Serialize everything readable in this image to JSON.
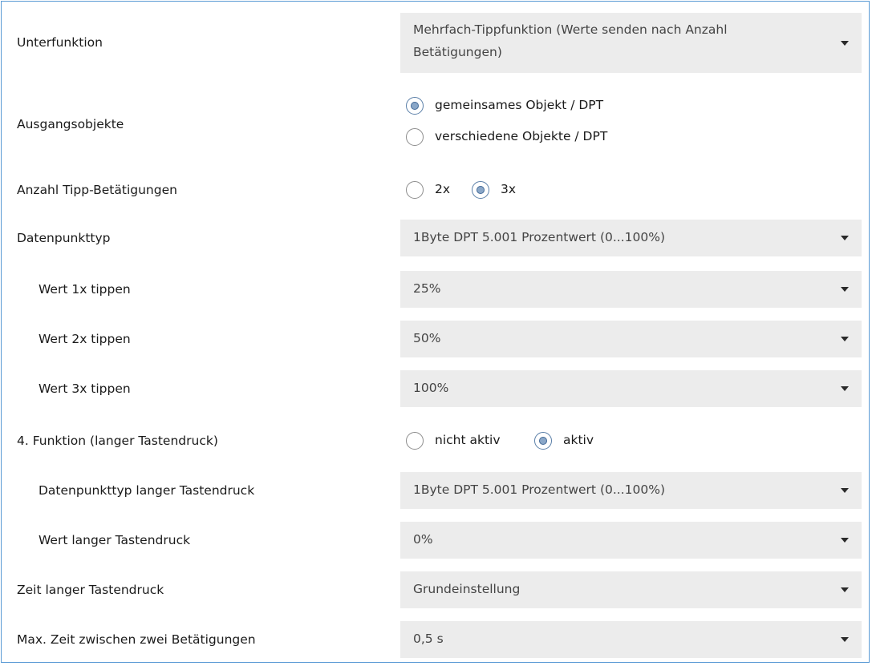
{
  "rows": {
    "unterfunktion": {
      "label": "Unterfunktion",
      "value": "Mehrfach-Tippfunktion (Werte senden nach Anzahl Betätigungen)"
    },
    "ausgangsobjekte": {
      "label": "Ausgangsobjekte",
      "options": [
        "gemeinsames Objekt / DPT",
        "verschiedene Objekte / DPT"
      ],
      "selected": "gemeinsames Objekt / DPT"
    },
    "anzahl_tipp": {
      "label": "Anzahl Tipp-Betätigungen",
      "options": [
        "2x",
        "3x"
      ],
      "selected": "3x"
    },
    "datenpunkttyp": {
      "label": "Datenpunkttyp",
      "value": "1Byte DPT 5.001 Prozentwert (0...100%)"
    },
    "wert1": {
      "label": "Wert 1x tippen",
      "value": "25%"
    },
    "wert2": {
      "label": "Wert 2x tippen",
      "value": "50%"
    },
    "wert3": {
      "label": "Wert 3x tippen",
      "value": "100%"
    },
    "funktion4": {
      "label": "4. Funktion (langer Tastendruck)",
      "options": [
        "nicht aktiv",
        "aktiv"
      ],
      "selected": "aktiv"
    },
    "dpt_lang": {
      "label": "Datenpunkttyp langer Tastendruck",
      "value": "1Byte DPT 5.001 Prozentwert (0...100%)"
    },
    "wert_lang": {
      "label": "Wert langer Tastendruck",
      "value": "0%"
    },
    "zeit_lang": {
      "label": "Zeit langer Tastendruck",
      "value": "Grundeinstellung"
    },
    "max_zeit": {
      "label": "Max. Zeit zwischen zwei Betätigungen",
      "value": "0,5 s"
    }
  },
  "colors": {
    "frame_border": "#5b9bd5",
    "select_bg": "#ececec",
    "radio_checked": "#8aa7c8"
  }
}
